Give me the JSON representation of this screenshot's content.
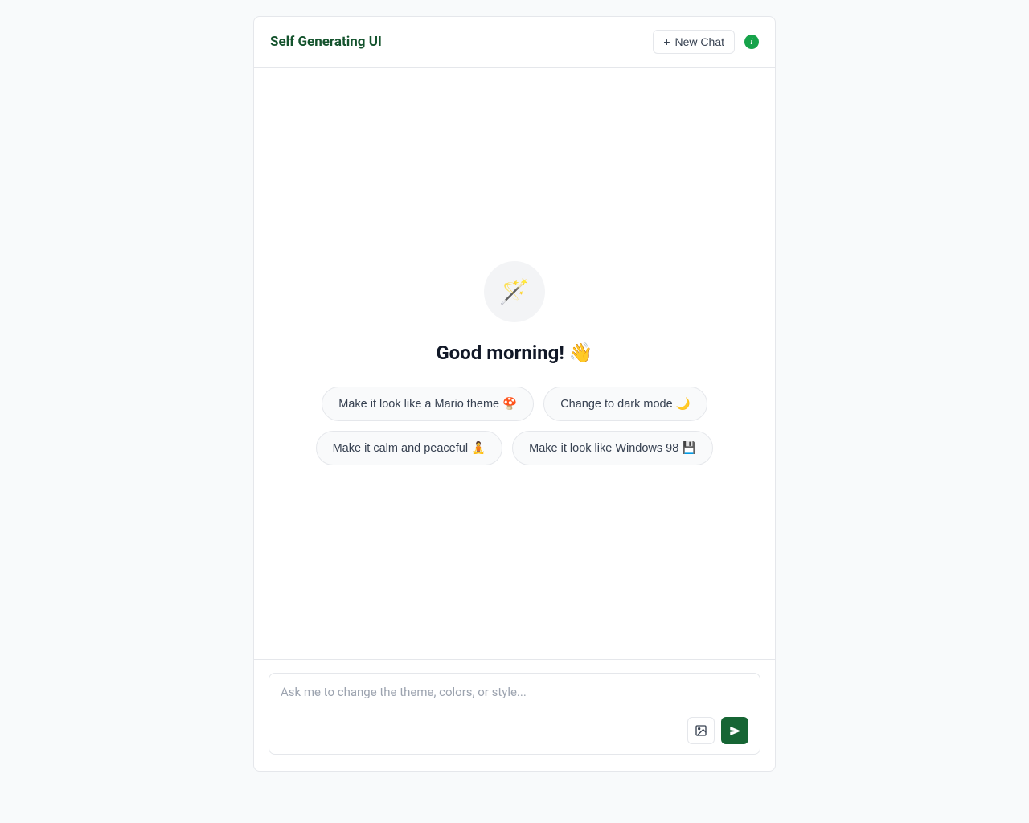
{
  "header": {
    "title": "Self Generating UI",
    "new_chat_label": "New Chat",
    "info_glyph": "i"
  },
  "main": {
    "avatar_glyph": "🪄",
    "greeting": "Good morning! 👋",
    "suggestions": [
      "Make it look like a Mario theme 🍄",
      "Change to dark mode 🌙",
      "Make it calm and peaceful 🧘",
      "Make it look like Windows 98 💾"
    ]
  },
  "composer": {
    "placeholder": "Ask me to change the theme, colors, or style..."
  },
  "colors": {
    "primary": "#166534",
    "title": "#14532d",
    "info_bg": "#16a34a"
  }
}
